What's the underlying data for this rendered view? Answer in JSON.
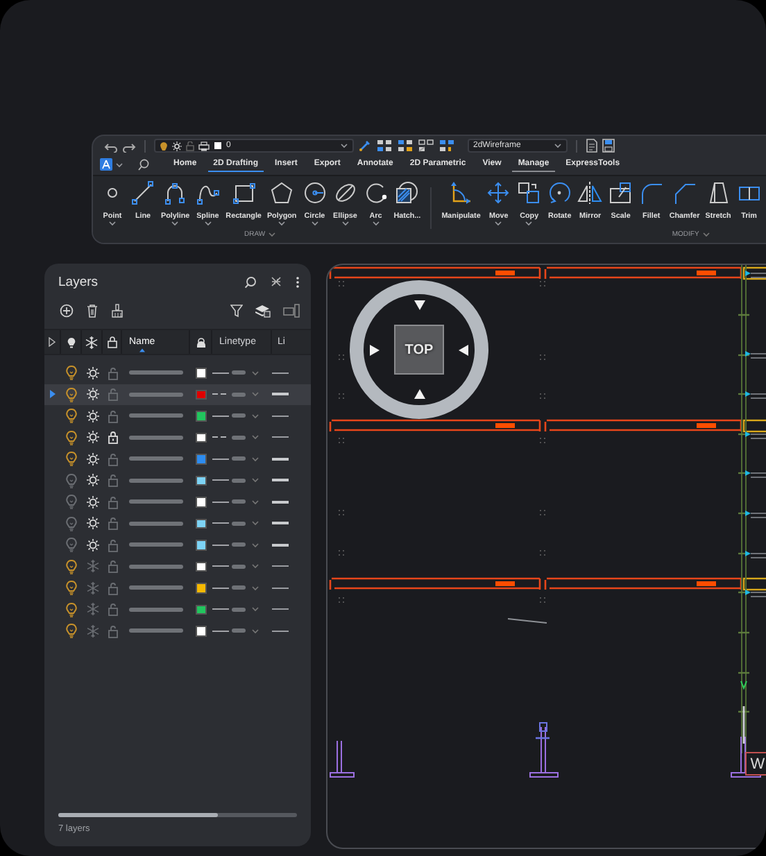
{
  "quick_access": {
    "layer_value": "0",
    "visual_style": "2dWireframe"
  },
  "ribbon_tabs": [
    {
      "label": "Home",
      "selected": false,
      "hovered": false
    },
    {
      "label": "2D Drafting",
      "selected": true,
      "hovered": false
    },
    {
      "label": "Insert",
      "selected": false,
      "hovered": false
    },
    {
      "label": "Export",
      "selected": false,
      "hovered": false
    },
    {
      "label": "Annotate",
      "selected": false,
      "hovered": false
    },
    {
      "label": "2D Parametric",
      "selected": false,
      "hovered": false
    },
    {
      "label": "View",
      "selected": false,
      "hovered": false
    },
    {
      "label": "Manage",
      "selected": false,
      "hovered": true
    },
    {
      "label": "ExpressTools",
      "selected": false,
      "hovered": false
    }
  ],
  "ribbon_panels": [
    {
      "title": "DRAW",
      "tools": [
        {
          "label": "Point",
          "has_dropdown": true
        },
        {
          "label": "Line",
          "has_dropdown": false
        },
        {
          "label": "Polyline",
          "has_dropdown": true
        },
        {
          "label": "Spline",
          "has_dropdown": true
        },
        {
          "label": "Rectangle",
          "has_dropdown": false
        },
        {
          "label": "Polygon",
          "has_dropdown": true
        },
        {
          "label": "Circle",
          "has_dropdown": true
        },
        {
          "label": "Ellipse",
          "has_dropdown": true
        },
        {
          "label": "Arc",
          "has_dropdown": true
        },
        {
          "label": "Hatch...",
          "has_dropdown": false
        }
      ]
    },
    {
      "title": "MODIFY",
      "tools": [
        {
          "label": "Manipulate",
          "has_dropdown": false
        },
        {
          "label": "Move",
          "has_dropdown": true
        },
        {
          "label": "Copy",
          "has_dropdown": true
        },
        {
          "label": "Rotate",
          "has_dropdown": false
        },
        {
          "label": "Mirror",
          "has_dropdown": false
        },
        {
          "label": "Scale",
          "has_dropdown": false
        },
        {
          "label": "Fillet",
          "has_dropdown": false
        },
        {
          "label": "Chamfer",
          "has_dropdown": false
        },
        {
          "label": "Stretch",
          "has_dropdown": false
        },
        {
          "label": "Trim",
          "has_dropdown": false
        }
      ]
    }
  ],
  "layers_panel": {
    "title": "Layers",
    "columns": [
      {
        "label": "Name",
        "sorted": true
      },
      {
        "label": "Linetype",
        "sorted": false
      },
      {
        "label": "Li",
        "sorted": false
      }
    ],
    "rows": [
      {
        "selected": false,
        "current": false,
        "on": true,
        "frozen": false,
        "locked": false,
        "color": "#ffffff",
        "dashed": false,
        "heavy": false
      },
      {
        "selected": true,
        "current": true,
        "on": true,
        "frozen": false,
        "locked": false,
        "color": "#e00000",
        "dashed": true,
        "heavy": true
      },
      {
        "selected": false,
        "current": false,
        "on": true,
        "frozen": false,
        "locked": false,
        "color": "#22c55e",
        "dashed": false,
        "heavy": false
      },
      {
        "selected": false,
        "current": false,
        "on": true,
        "frozen": false,
        "locked": true,
        "color": "#ffffff",
        "dashed": true,
        "heavy": false
      },
      {
        "selected": false,
        "current": false,
        "on": true,
        "frozen": false,
        "locked": false,
        "color": "#2d8cf0",
        "dashed": false,
        "heavy": true
      },
      {
        "selected": false,
        "current": false,
        "on": false,
        "frozen": false,
        "locked": false,
        "color": "#7dd3f5",
        "dashed": false,
        "heavy": true
      },
      {
        "selected": false,
        "current": false,
        "on": false,
        "frozen": false,
        "locked": false,
        "color": "#ffffff",
        "dashed": false,
        "heavy": true
      },
      {
        "selected": false,
        "current": false,
        "on": false,
        "frozen": false,
        "locked": false,
        "color": "#7dd3f5",
        "dashed": false,
        "heavy": true
      },
      {
        "selected": false,
        "current": false,
        "on": false,
        "frozen": false,
        "locked": false,
        "color": "#7dd3f5",
        "dashed": false,
        "heavy": true
      },
      {
        "selected": false,
        "current": false,
        "on": true,
        "frozen": true,
        "locked": false,
        "color": "#ffffff",
        "dashed": false,
        "heavy": false
      },
      {
        "selected": false,
        "current": false,
        "on": true,
        "frozen": true,
        "locked": false,
        "color": "#f5b800",
        "dashed": false,
        "heavy": false
      },
      {
        "selected": false,
        "current": false,
        "on": true,
        "frozen": true,
        "locked": false,
        "color": "#22c55e",
        "dashed": false,
        "heavy": false
      },
      {
        "selected": false,
        "current": false,
        "on": true,
        "frozen": true,
        "locked": false,
        "color": "#ffffff",
        "dashed": false,
        "heavy": false
      }
    ],
    "footer": "7 layers"
  },
  "viewport": {
    "view_cube": "TOP",
    "ucs_label": "W"
  }
}
